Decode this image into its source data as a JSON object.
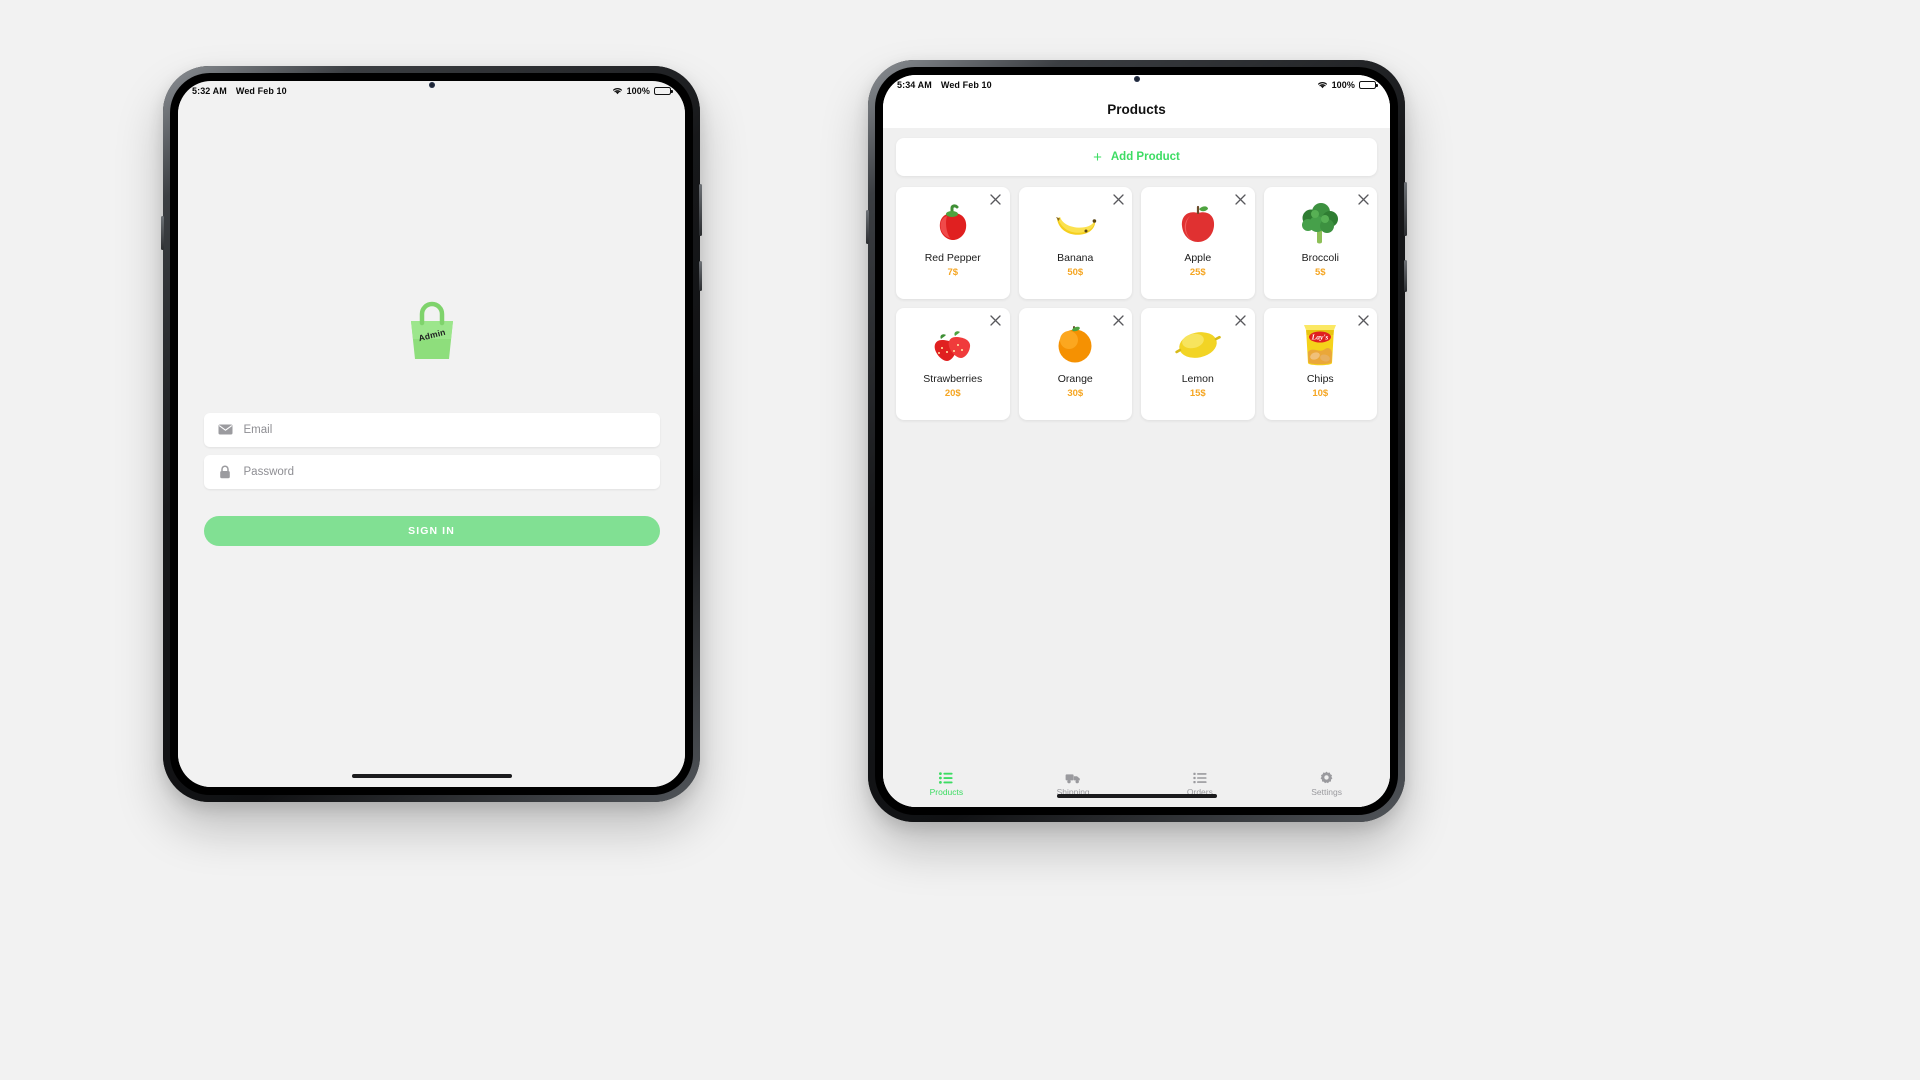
{
  "colors": {
    "accent_green": "#3ddc63",
    "button_green": "#81e093",
    "price_orange": "#f5a623",
    "page_bg": "#f2f2f2",
    "card_bg": "#ffffff",
    "inactive_gray": "#9a9a9e"
  },
  "left_device": {
    "status": {
      "time": "5:32 AM",
      "date": "Wed Feb 10",
      "battery_percent": "100%",
      "wifi_icon": "wifi-icon",
      "battery_icon": "battery-full-icon"
    },
    "login": {
      "logo_icon": "shopping-bag-logo-icon",
      "logo_text": "Admin",
      "email": {
        "icon": "envelope-icon",
        "placeholder": "Email",
        "value": ""
      },
      "password": {
        "icon": "lock-icon",
        "placeholder": "Password",
        "value": ""
      },
      "sign_in_label": "SIGN IN"
    }
  },
  "right_device": {
    "status": {
      "time": "5:34 AM",
      "date": "Wed Feb 10",
      "battery_percent": "100%",
      "wifi_icon": "wifi-icon",
      "battery_icon": "battery-full-icon"
    },
    "header": {
      "title": "Products"
    },
    "add_product": {
      "plus_icon": "plus-icon",
      "label": "Add Product"
    },
    "products": [
      {
        "name": "Red Pepper",
        "price": "7$",
        "icon": "red-pepper-icon",
        "close_icon": "close-icon"
      },
      {
        "name": "Banana",
        "price": "50$",
        "icon": "banana-icon",
        "close_icon": "close-icon"
      },
      {
        "name": "Apple",
        "price": "25$",
        "icon": "apple-icon",
        "close_icon": "close-icon"
      },
      {
        "name": "Broccoli",
        "price": "5$",
        "icon": "broccoli-icon",
        "close_icon": "close-icon"
      },
      {
        "name": "Strawberries",
        "price": "20$",
        "icon": "strawberries-icon",
        "close_icon": "close-icon"
      },
      {
        "name": "Orange",
        "price": "30$",
        "icon": "orange-icon",
        "close_icon": "close-icon"
      },
      {
        "name": "Lemon",
        "price": "15$",
        "icon": "lemon-icon",
        "close_icon": "close-icon"
      },
      {
        "name": "Chips",
        "price": "10$",
        "icon": "chips-bag-icon",
        "close_icon": "close-icon"
      }
    ],
    "tabs": [
      {
        "label": "Products",
        "icon": "list-icon",
        "active": true
      },
      {
        "label": "Shipping",
        "icon": "truck-icon",
        "active": false
      },
      {
        "label": "Orders",
        "icon": "orders-icon",
        "active": false
      },
      {
        "label": "Settings",
        "icon": "gear-icon",
        "active": false
      }
    ]
  }
}
